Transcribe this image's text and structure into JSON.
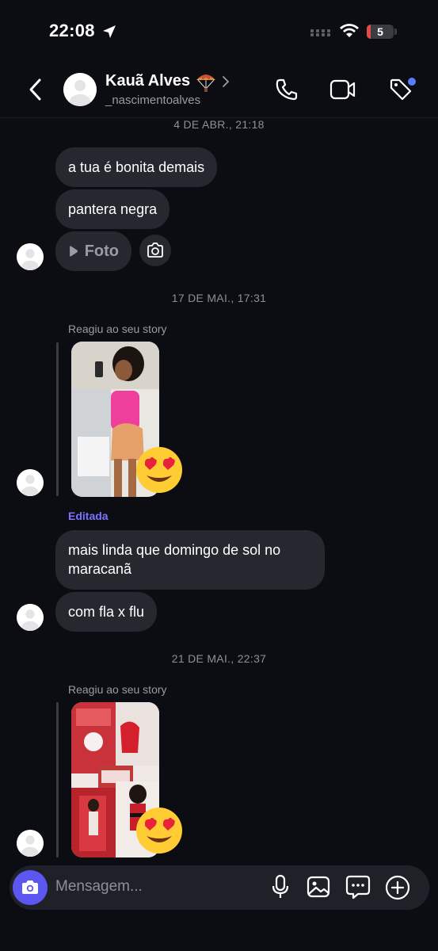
{
  "status_bar": {
    "time": "22:08",
    "battery": "5"
  },
  "header": {
    "name": "Kauã Alves",
    "username": "_nascimentoalves"
  },
  "messages": {
    "date_1": "4 DE ABR., 21:18",
    "msg_1": "a tua é bonita demais",
    "msg_2": "pantera negra",
    "photo_label": "Foto",
    "date_2": "17 DE MAI., 17:31",
    "story_reaction_1": "Reagiu ao seu story",
    "edited_label": "Editada",
    "msg_3": "mais linda que domingo de sol no maracanã",
    "msg_4": "com fla x flu",
    "date_3": "21 DE MAI., 22:37",
    "story_reaction_2": "Reagiu ao seu story",
    "reaction_emoji": "😍"
  },
  "composer": {
    "placeholder": "Mensagem..."
  },
  "colors": {
    "background": "#0b0d12",
    "bubble": "#262830",
    "accent": "#5b57f0",
    "edited": "#7b73ff"
  }
}
